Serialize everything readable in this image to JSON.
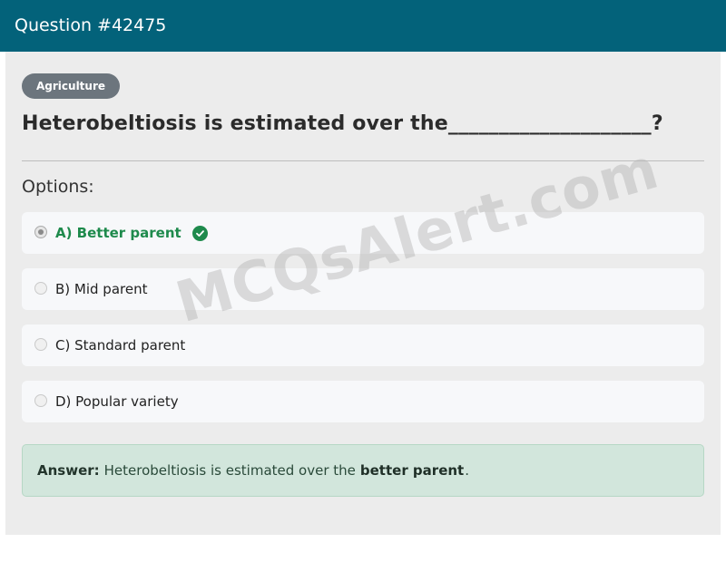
{
  "header": {
    "title": "Question #42475"
  },
  "category": "Agriculture",
  "question": "Heterobeltiosis is estimated over the____________________?",
  "options_label": "Options:",
  "options": [
    {
      "label": "A) Better parent",
      "correct": true,
      "selected": true
    },
    {
      "label": "B) Mid parent",
      "correct": false,
      "selected": false
    },
    {
      "label": "C) Standard parent",
      "correct": false,
      "selected": false
    },
    {
      "label": "D) Popular variety",
      "correct": false,
      "selected": false
    }
  ],
  "answer": {
    "label": "Answer:",
    "text_prefix": "Heterobeltiosis is estimated over the",
    "highlight": "better parent",
    "suffix": "."
  },
  "watermark": "MCQsAlert.com",
  "colors": {
    "header_bg": "#03627a",
    "correct": "#1e8a4c",
    "answer_bg": "#d2e6dc",
    "badge_bg": "#6c757d"
  }
}
